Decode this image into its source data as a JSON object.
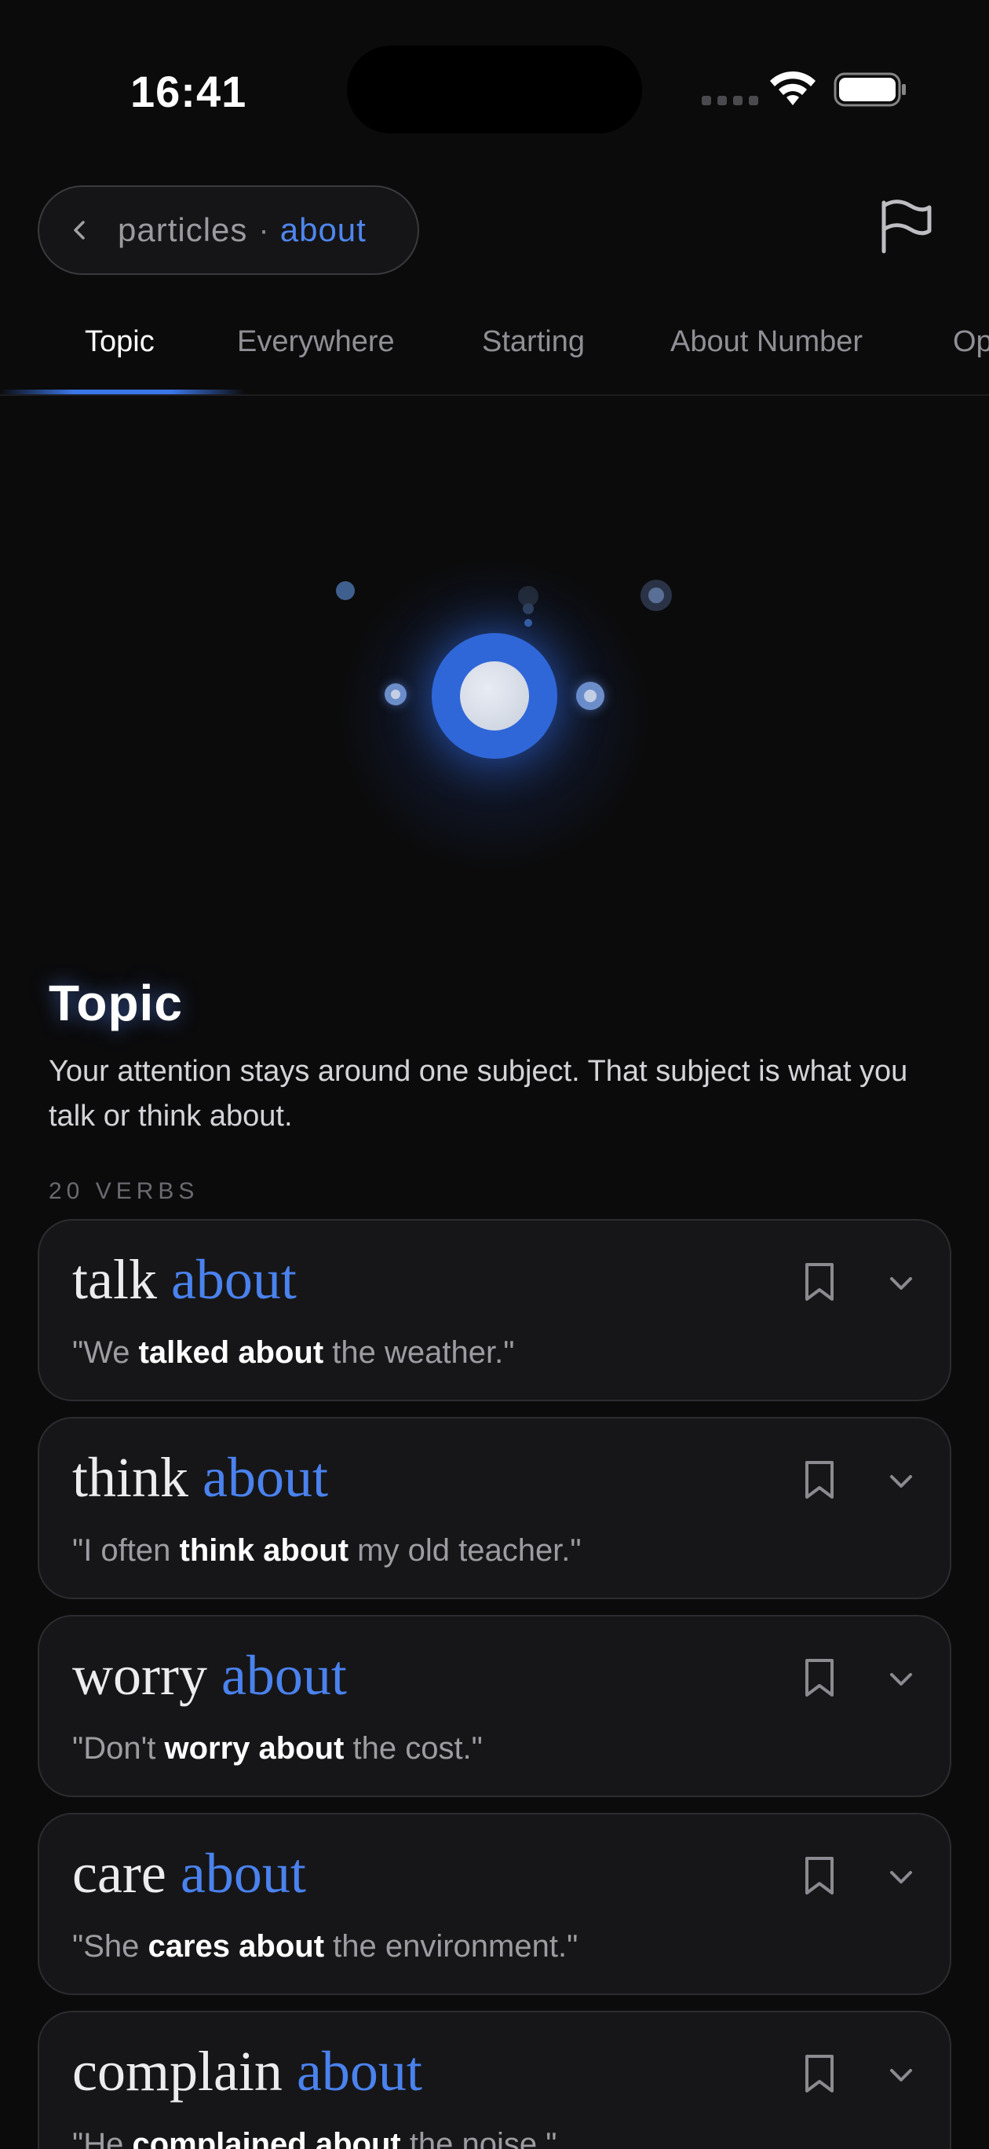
{
  "status_bar": {
    "time": "16:41"
  },
  "header": {
    "breadcrumb_parent": "particles",
    "breadcrumb_separator": "·",
    "breadcrumb_current": "about",
    "back_icon": "chevron-left-icon",
    "flag_icon": "flag-icon"
  },
  "tabs": [
    {
      "label": "Topic",
      "active": true
    },
    {
      "label": "Everywhere",
      "active": false
    },
    {
      "label": "Starting",
      "active": false
    },
    {
      "label": "About Number",
      "active": false
    },
    {
      "label": "Op",
      "active": false
    }
  ],
  "colors": {
    "accent": "#3b76e6",
    "background": "#0b0b0c",
    "card": "#161618"
  },
  "section": {
    "title": "Topic",
    "description": "Your attention stays around one subject. That subject is what you talk or think about.",
    "count_label": "20 VERBS"
  },
  "verbs": [
    {
      "verb": "talk",
      "particle": "about",
      "example_pre": "\"We ",
      "example_bold": "talked about",
      "example_post": " the weather.\""
    },
    {
      "verb": "think",
      "particle": "about",
      "example_pre": "\"I often ",
      "example_bold": "think about",
      "example_post": " my old teacher.\""
    },
    {
      "verb": "worry",
      "particle": "about",
      "example_pre": "\"Don't ",
      "example_bold": "worry about",
      "example_post": " the cost.\""
    },
    {
      "verb": "care",
      "particle": "about",
      "example_pre": "\"She ",
      "example_bold": "cares about",
      "example_post": " the environment.\""
    },
    {
      "verb": "complain",
      "particle": "about",
      "example_pre": "\"He ",
      "example_bold": "complained about",
      "example_post": " the noise.\""
    }
  ]
}
